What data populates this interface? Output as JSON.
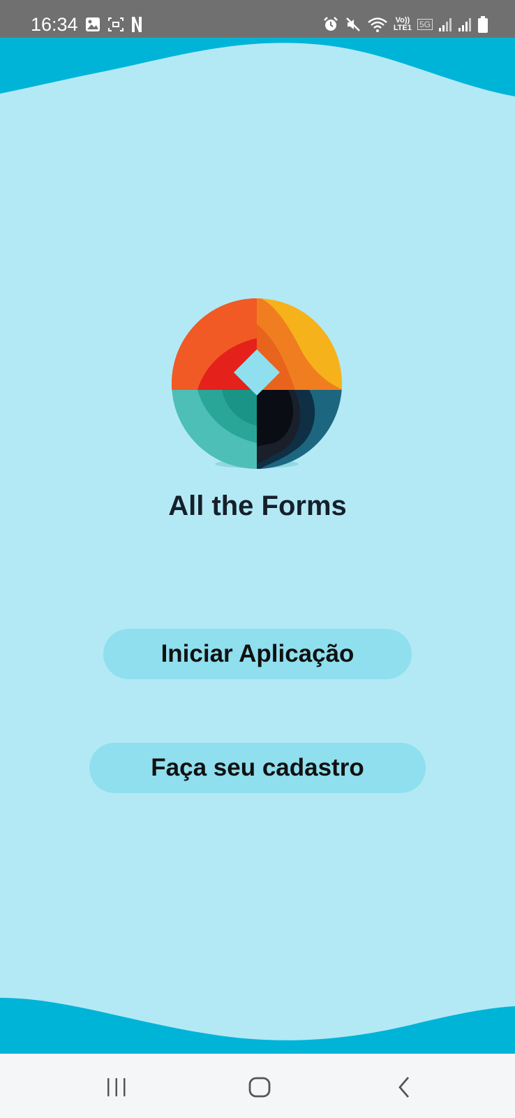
{
  "status_bar": {
    "time": "16:34",
    "left_icons": [
      "image-icon",
      "screen-record-icon",
      "netflix-icon"
    ],
    "right_icons": [
      "alarm-icon",
      "mute-icon",
      "wifi-icon",
      "volte-icon",
      "5g-icon",
      "signal-icon",
      "signal-icon",
      "battery-icon"
    ],
    "volte_top": "Vo))",
    "volte_bottom": "LTE1",
    "network_label": "5G"
  },
  "app": {
    "title": "All the Forms",
    "logo": "all-the-forms-logo",
    "buttons": {
      "start_label": "Iniciar Aplicação",
      "signup_label": "Faça seu cadastro"
    },
    "colors": {
      "background": "#b3e9f5",
      "wave": "#00b4d8",
      "button": "#8fdfee",
      "title_text": "#15202b"
    }
  },
  "navigation_bar": {
    "buttons": [
      "recents-icon",
      "home-icon",
      "back-icon"
    ]
  }
}
